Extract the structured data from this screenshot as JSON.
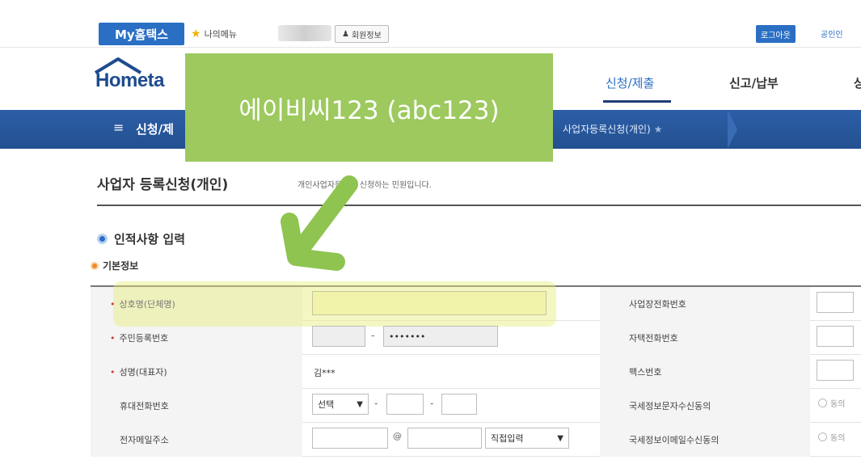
{
  "util_bar": {
    "my_hometax": "My홈택스",
    "my_menu": "나의메뉴",
    "member_info": "회원정보",
    "logout": "로그아웃",
    "cert_link": "공인인"
  },
  "header": {
    "logo_text": "Hometa",
    "nav": {
      "tab1": "신청/제출",
      "tab2": "신고/납부",
      "tab3": "상"
    }
  },
  "breadcrumb": {
    "first": "신청/제",
    "current": "사업자등록신청(개인)"
  },
  "page": {
    "title": "사업자 등록신청(개인)",
    "description": "개인사업자등록을 신청하는 민원입니다."
  },
  "section": {
    "title": "인적사항 입력",
    "subtitle": "기본정보"
  },
  "form": {
    "left": {
      "row1_label": "상호명(단체명)",
      "row2_label": "주민등록번호",
      "row2_masked": "•••••••",
      "row3_label": "성명(대표자)",
      "row3_value": "김***",
      "row4_label": "휴대전화번호",
      "row4_select": "선택",
      "row5_label": "전자메일주소",
      "row5_at": "@",
      "row5_select": "직접입력"
    },
    "right": {
      "row1_label": "사업장전화번호",
      "row2_label": "자택전화번호",
      "row3_label": "팩스번호",
      "row4_label": "국세정보문자수신동의",
      "row4_option": "동의",
      "row5_label": "국세정보이메일수신동의",
      "row5_option": "동의"
    }
  },
  "overlay": {
    "text": "에이비씨123 (abc123)"
  },
  "colors": {
    "brand_blue": "#2a6fc4",
    "breadcrumb_bar": "#23508f",
    "overlay_green": "#9dc95e",
    "highlight_yellow": "#e6ee78",
    "arrow_green": "#8ec44f"
  },
  "icons": {
    "favorite": "star-icon",
    "member": "person-icon",
    "menu": "hamburger-icon",
    "annotation": "arrow-icon"
  }
}
